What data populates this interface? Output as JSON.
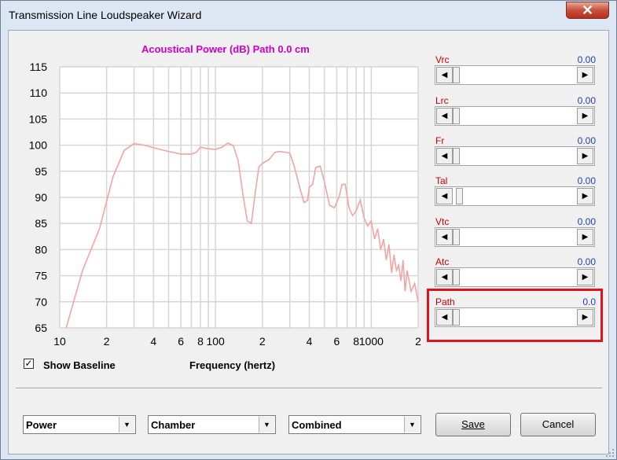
{
  "window": {
    "title": "Transmission Line Loudspeaker Wizard",
    "close_label": "✕"
  },
  "chart": {
    "title": "Acoustical Power (dB)   Path 0.0 cm"
  },
  "chart_data": {
    "type": "line",
    "title": "Acoustical Power (dB)   Path 0.0 cm",
    "xlabel": "Frequency (hertz)",
    "ylabel": "",
    "xscale": "log",
    "xlim": [
      10,
      2000
    ],
    "ylim": [
      65,
      115
    ],
    "y_ticks": [
      115,
      110,
      105,
      100,
      95,
      90,
      85,
      80,
      75,
      70,
      65
    ],
    "x_tick_labels": [
      {
        "x": 10,
        "label": "10"
      },
      {
        "x": 20,
        "label": "2"
      },
      {
        "x": 40,
        "label": "4"
      },
      {
        "x": 60,
        "label": "6"
      },
      {
        "x": 80,
        "label": "8"
      },
      {
        "x": 100,
        "label": "100"
      },
      {
        "x": 200,
        "label": "2"
      },
      {
        "x": 400,
        "label": "4"
      },
      {
        "x": 600,
        "label": "6"
      },
      {
        "x": 800,
        "label": "8"
      },
      {
        "x": 1000,
        "label": "1000"
      },
      {
        "x": 2000,
        "label": "2"
      }
    ],
    "grid": true,
    "series_color": "#f4a3a3",
    "series": [
      {
        "x": [
          11,
          14,
          18,
          22,
          26,
          30,
          35,
          40,
          50,
          60,
          70,
          75,
          80,
          90,
          100,
          110,
          120,
          130,
          140,
          150,
          160,
          170,
          180,
          190,
          200,
          220,
          240,
          260,
          300,
          320,
          350,
          370,
          390,
          400,
          420,
          440,
          470,
          500,
          540,
          580,
          620,
          650,
          680,
          720,
          760,
          800,
          850,
          900,
          950,
          1000,
          1050,
          1100,
          1150,
          1200,
          1250,
          1300,
          1350,
          1400,
          1450,
          1500,
          1550,
          1600,
          1650,
          1700,
          1800,
          1900,
          2000
        ],
        "y": [
          65,
          76,
          84,
          94,
          99,
          100.3,
          100,
          99.5,
          98.8,
          98.3,
          98.3,
          98.6,
          99.6,
          99.3,
          99.2,
          99.6,
          100.4,
          99.9,
          97,
          90.5,
          85.5,
          85,
          91,
          95.8,
          96.5,
          97.2,
          98.6,
          98.8,
          98.5,
          96,
          91.5,
          89,
          89.4,
          92,
          92.5,
          95.7,
          96,
          93,
          88.5,
          88,
          90,
          92.5,
          92.5,
          88,
          86.5,
          87.4,
          89.5,
          86,
          84.5,
          85.5,
          82,
          84,
          80,
          82,
          78,
          81,
          75.5,
          79,
          76,
          77,
          74,
          78,
          72,
          76,
          72,
          73.5,
          70
        ]
      }
    ]
  },
  "sliders": [
    {
      "label": "Vrc",
      "value": "0.00",
      "position": 0.0
    },
    {
      "label": "Lrc",
      "value": "0.00",
      "position": 0.0
    },
    {
      "label": "Fr",
      "value": "0.00",
      "position": 0.0
    },
    {
      "label": "Tal",
      "value": "0.00",
      "position": 0.03
    },
    {
      "label": "Vtc",
      "value": "0.00",
      "position": 0.0
    },
    {
      "label": "Atc",
      "value": "0.00",
      "position": 0.0
    },
    {
      "label": "Path",
      "value": "0.0",
      "position": 0.0
    }
  ],
  "checkbox": {
    "label": "Show Baseline",
    "checked": true,
    "check_glyph": "✓"
  },
  "xaxis_label": "Frequency (hertz)",
  "combos": [
    {
      "value": "Power"
    },
    {
      "value": "Chamber"
    },
    {
      "value": "Combined"
    }
  ],
  "buttons": {
    "save": "Save",
    "cancel": "Cancel"
  },
  "arrows": {
    "left": "◀",
    "right": "▶",
    "down": "▼"
  }
}
